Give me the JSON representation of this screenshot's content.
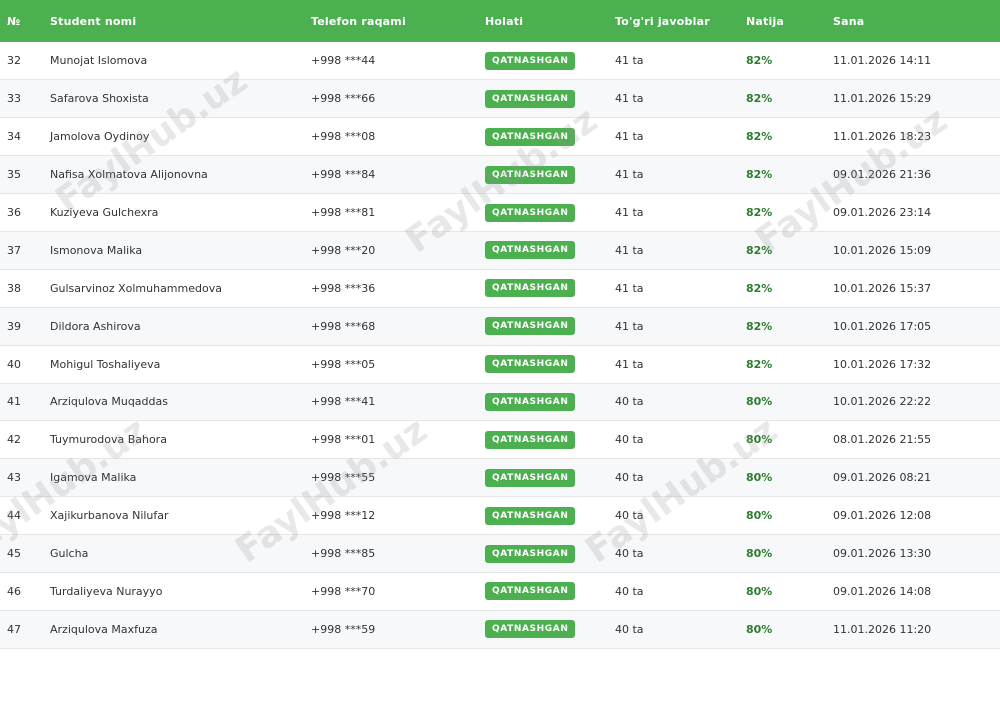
{
  "table": {
    "headers": [
      "№",
      "Student nomi",
      "Telefon raqami",
      "Holati",
      "To'g'ri javoblar",
      "Natija",
      "Sana"
    ],
    "rows": [
      {
        "num": "32",
        "name": "Munojat Islomova",
        "phone": "+998 ***44",
        "status": "QATNASHGAN",
        "correct": "41 ta",
        "result": "82%",
        "date": "11.01.2026 14:11"
      },
      {
        "num": "33",
        "name": "Safarova Shoxista",
        "phone": "+998 ***66",
        "status": "QATNASHGAN",
        "correct": "41 ta",
        "result": "82%",
        "date": "11.01.2026 15:29"
      },
      {
        "num": "34",
        "name": "Jamolova Oydinoy",
        "phone": "+998 ***08",
        "status": "QATNASHGAN",
        "correct": "41 ta",
        "result": "82%",
        "date": "11.01.2026 18:23"
      },
      {
        "num": "35",
        "name": "Nafisa Xolmatova Alijonovna",
        "phone": "+998 ***84",
        "status": "QATNASHGAN",
        "correct": "41 ta",
        "result": "82%",
        "date": "09.01.2026 21:36"
      },
      {
        "num": "36",
        "name": "Kuziyeva Gulchexra",
        "phone": "+998 ***81",
        "status": "QATNASHGAN",
        "correct": "41 ta",
        "result": "82%",
        "date": "09.01.2026 23:14"
      },
      {
        "num": "37",
        "name": "Ismonova Malika",
        "phone": "+998 ***20",
        "status": "QATNASHGAN",
        "correct": "41 ta",
        "result": "82%",
        "date": "10.01.2026 15:09"
      },
      {
        "num": "38",
        "name": "Gulsarvinoz Xolmuhammedova",
        "phone": "+998 ***36",
        "status": "QATNASHGAN",
        "correct": "41 ta",
        "result": "82%",
        "date": "10.01.2026 15:37"
      },
      {
        "num": "39",
        "name": "Dildora Ashirova",
        "phone": "+998 ***68",
        "status": "QATNASHGAN",
        "correct": "41 ta",
        "result": "82%",
        "date": "10.01.2026 17:05"
      },
      {
        "num": "40",
        "name": "Mohigul Toshaliyeva",
        "phone": "+998 ***05",
        "status": "QATNASHGAN",
        "correct": "41 ta",
        "result": "82%",
        "date": "10.01.2026 17:32"
      },
      {
        "num": "41",
        "name": "Arziqulova Muqaddas",
        "phone": "+998 ***41",
        "status": "QATNASHGAN",
        "correct": "40 ta",
        "result": "80%",
        "date": "10.01.2026 22:22"
      },
      {
        "num": "42",
        "name": "Tuymurodova Bahora",
        "phone": "+998 ***01",
        "status": "QATNASHGAN",
        "correct": "40 ta",
        "result": "80%",
        "date": "08.01.2026 21:55"
      },
      {
        "num": "43",
        "name": "Igamova Malika",
        "phone": "+998 ***55",
        "status": "QATNASHGAN",
        "correct": "40 ta",
        "result": "80%",
        "date": "09.01.2026 08:21"
      },
      {
        "num": "44",
        "name": "Xajikurbanova Nilufar",
        "phone": "+998 ***12",
        "status": "QATNASHGAN",
        "correct": "40 ta",
        "result": "80%",
        "date": "09.01.2026 12:08"
      },
      {
        "num": "45",
        "name": "Gulcha",
        "phone": "+998 ***85",
        "status": "QATNASHGAN",
        "correct": "40 ta",
        "result": "80%",
        "date": "09.01.2026 13:30"
      },
      {
        "num": "46",
        "name": "Turdaliyeva Nurayyo",
        "phone": "+998 ***70",
        "status": "QATNASHGAN",
        "correct": "40 ta",
        "result": "80%",
        "date": "09.01.2026 14:08"
      },
      {
        "num": "47",
        "name": "Arziqulova Maxfuza",
        "phone": "+998 ***59",
        "status": "QATNASHGAN",
        "correct": "40 ta",
        "result": "80%",
        "date": "11.01.2026 11:20"
      }
    ]
  },
  "watermark": {
    "text": "FaylHub.uz"
  },
  "colors": {
    "header_bg": "#4caf50",
    "badge_bg": "#4caf50",
    "result_text": "#2e7d32"
  }
}
